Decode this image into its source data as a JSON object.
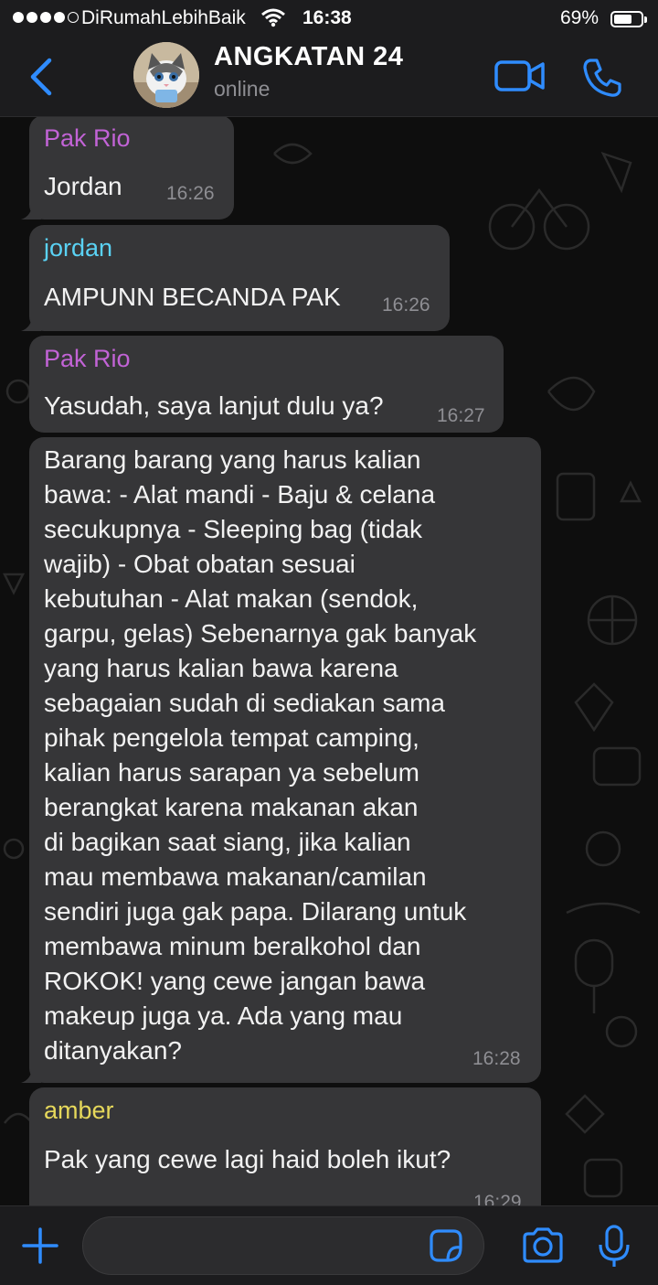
{
  "status_bar": {
    "carrier": "DiRumahLebihBaik",
    "time": "16:38",
    "battery": "69%",
    "battery_level": 0.69
  },
  "header": {
    "title": "ANGKATAN 24",
    "subtitle": "online"
  },
  "messages": [
    {
      "sender": "Pak Rio",
      "sender_color": "#c263d6",
      "text": "Jordan",
      "time": "16:26"
    },
    {
      "sender": "jordan",
      "sender_color": "#5ad2f4",
      "text": "AMPUNN BECANDA PAK",
      "time": "16:26"
    },
    {
      "sender": "Pak Rio",
      "sender_color": "#c263d6",
      "text": "Yasudah, saya lanjut dulu ya?",
      "time": "16:27"
    },
    {
      "sender": "",
      "sender_color": "",
      "lines": [
        "Barang barang yang harus kalian",
        "bawa: - Alat mandi - Baju & celana",
        "secukupnya - Sleeping bag (tidak",
        "wajib) - Obat obatan sesuai",
        "kebutuhan - Alat makan (sendok,",
        "garpu, gelas) Sebenarnya gak banyak",
        "yang harus kalian bawa karena",
        "sebagaian sudah di sediakan sama",
        "pihak pengelola tempat camping,",
        "kalian harus sarapan ya sebelum",
        "berangkat karena makanan akan",
        "di bagikan saat siang, jika kalian",
        "mau membawa makanan/camilan",
        "sendiri juga gak papa. Dilarang untuk",
        "membawa minum beralkohol dan",
        "ROKOK! yang cewe jangan bawa",
        "makeup juga ya. Ada yang mau",
        "ditanyakan?"
      ],
      "time": "16:28"
    },
    {
      "sender": "amber",
      "sender_color": "#e6d85b",
      "text": "Pak yang cewe lagi haid boleh ikut?",
      "time": "16:29"
    }
  ],
  "composer": {
    "placeholder": ""
  },
  "colors": {
    "accent": "#2f8cff",
    "bubble": "#363638",
    "bar": "#1c1c1e"
  },
  "icons": [
    "back-chevron-icon",
    "video-call-icon",
    "phone-call-icon",
    "plus-icon",
    "sticker-icon",
    "camera-icon",
    "microphone-icon"
  ]
}
